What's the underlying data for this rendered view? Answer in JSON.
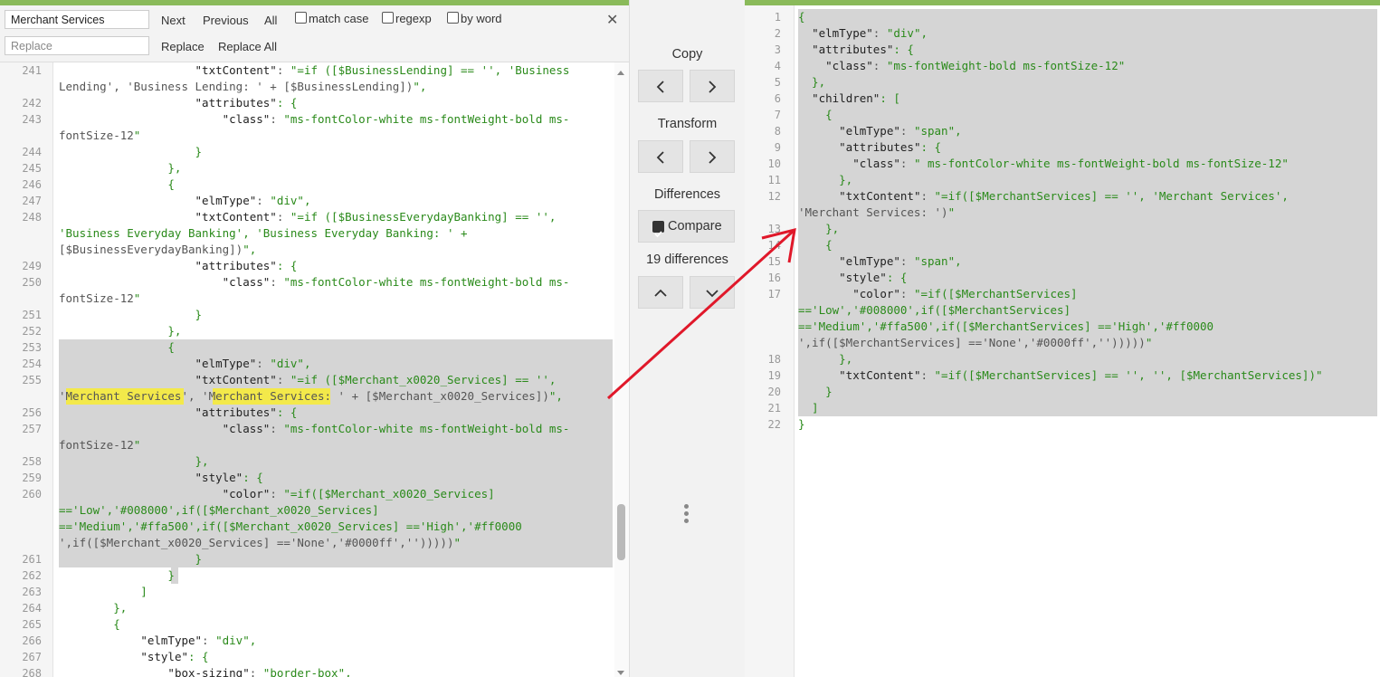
{
  "find": {
    "search_value": "Merchant Services",
    "replace_placeholder": "Replace",
    "next_label": "Next",
    "previous_label": "Previous",
    "all_label": "All",
    "match_case_label": "match case",
    "regexp_label": "regexp",
    "by_word_label": "by word",
    "replace_label": "Replace",
    "replace_all_label": "Replace All",
    "close_glyph": "✕"
  },
  "middle": {
    "copy_label": "Copy",
    "transform_label": "Transform",
    "differences_label": "Differences",
    "compare_label": "Compare",
    "diff_count": "19 differences"
  },
  "colors": {
    "accent_bar": "#8aba5a",
    "highlight": "#d5d5d5",
    "match": "#f3e94a",
    "string": "#2a8a1a",
    "arrow": "#e0182a"
  },
  "left_lines": [
    {
      "n": "241",
      "t": "                    \"txtContent\": \"=if ([$BusinessLending] == '', 'Business"
    },
    {
      "n": "",
      "t": "Lending', 'Business Lending: ' + [$BusinessLending])\","
    },
    {
      "n": "242",
      "t": "                    \"attributes\": {"
    },
    {
      "n": "243",
      "t": "                        \"class\": \"ms-fontColor-white ms-fontWeight-bold ms-"
    },
    {
      "n": "",
      "t": "fontSize-12\""
    },
    {
      "n": "244",
      "t": "                    }"
    },
    {
      "n": "245",
      "t": "                },"
    },
    {
      "n": "246",
      "t": "                {"
    },
    {
      "n": "247",
      "t": "                    \"elmType\": \"div\","
    },
    {
      "n": "248",
      "t": "                    \"txtContent\": \"=if ([$BusinessEverydayBanking] == '',"
    },
    {
      "n": "",
      "t": "'Business Everyday Banking', 'Business Everyday Banking: ' +"
    },
    {
      "n": "",
      "t": "[$BusinessEverydayBanking])\","
    },
    {
      "n": "249",
      "t": "                    \"attributes\": {"
    },
    {
      "n": "250",
      "t": "                        \"class\": \"ms-fontColor-white ms-fontWeight-bold ms-"
    },
    {
      "n": "",
      "t": "fontSize-12\""
    },
    {
      "n": "251",
      "t": "                    }"
    },
    {
      "n": "252",
      "t": "                },"
    },
    {
      "n": "253",
      "t": "                {"
    },
    {
      "n": "254",
      "t": "                    \"elmType\": \"div\","
    },
    {
      "n": "255",
      "t": "                    \"txtContent\": \"=if ([$Merchant_x0020_Services] == '',"
    },
    {
      "n": "",
      "t": "'Merchant Services', 'Merchant Services: ' + [$Merchant_x0020_Services])\","
    },
    {
      "n": "256",
      "t": "                    \"attributes\": {"
    },
    {
      "n": "257",
      "t": "                        \"class\": \"ms-fontColor-white ms-fontWeight-bold ms-"
    },
    {
      "n": "",
      "t": "fontSize-12\""
    },
    {
      "n": "258",
      "t": "                    },"
    },
    {
      "n": "259",
      "t": "                    \"style\": {"
    },
    {
      "n": "260",
      "t": "                        \"color\": \"=if([$Merchant_x0020_Services]"
    },
    {
      "n": "",
      "t": "=='Low','#008000',if([$Merchant_x0020_Services]"
    },
    {
      "n": "",
      "t": "=='Medium','#ffa500',if([$Merchant_x0020_Services] =='High','#ff0000"
    },
    {
      "n": "",
      "t": "',if([$Merchant_x0020_Services] =='None','#0000ff','')))))\""
    },
    {
      "n": "261",
      "t": "                    }"
    },
    {
      "n": "262",
      "t": "                }"
    },
    {
      "n": "263",
      "t": "            ]"
    },
    {
      "n": "264",
      "t": "        },"
    },
    {
      "n": "265",
      "t": "        {"
    },
    {
      "n": "266",
      "t": "            \"elmType\": \"div\","
    },
    {
      "n": "267",
      "t": "            \"style\": {"
    },
    {
      "n": "268",
      "t": "                \"box-sizing\": \"border-box\","
    }
  ],
  "right_lines": [
    {
      "n": "1",
      "t": "{"
    },
    {
      "n": "2",
      "t": "  \"elmType\": \"div\","
    },
    {
      "n": "3",
      "t": "  \"attributes\": {"
    },
    {
      "n": "4",
      "t": "    \"class\": \"ms-fontWeight-bold ms-fontSize-12\""
    },
    {
      "n": "5",
      "t": "  },"
    },
    {
      "n": "6",
      "t": "  \"children\": ["
    },
    {
      "n": "7",
      "t": "    {"
    },
    {
      "n": "8",
      "t": "      \"elmType\": \"span\","
    },
    {
      "n": "9",
      "t": "      \"attributes\": {"
    },
    {
      "n": "10",
      "t": "        \"class\": \" ms-fontColor-white ms-fontWeight-bold ms-fontSize-12\""
    },
    {
      "n": "11",
      "t": "      },"
    },
    {
      "n": "12",
      "t": "      \"txtContent\": \"=if([$MerchantServices] == '', 'Merchant Services',"
    },
    {
      "n": "",
      "t": "'Merchant Services: ')\""
    },
    {
      "n": "13",
      "t": "    },"
    },
    {
      "n": "14",
      "t": "    {"
    },
    {
      "n": "15",
      "t": "      \"elmType\": \"span\","
    },
    {
      "n": "16",
      "t": "      \"style\": {"
    },
    {
      "n": "17",
      "t": "        \"color\": \"=if([$MerchantServices]"
    },
    {
      "n": "",
      "t": "=='Low','#008000',if([$MerchantServices]"
    },
    {
      "n": "",
      "t": "=='Medium','#ffa500',if([$MerchantServices] =='High','#ff0000"
    },
    {
      "n": "",
      "t": "',if([$MerchantServices] =='None','#0000ff','')))))\""
    },
    {
      "n": "18",
      "t": "      },"
    },
    {
      "n": "19",
      "t": "      \"txtContent\": \"=if([$MerchantServices] == '', '', [$MerchantServices])\""
    },
    {
      "n": "20",
      "t": "    }"
    },
    {
      "n": "21",
      "t": "  ]"
    },
    {
      "n": "22",
      "t": "}"
    }
  ]
}
